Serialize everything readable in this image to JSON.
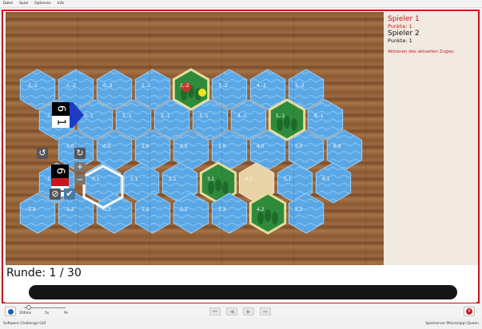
{
  "menu": [
    "Datei",
    "Spiel",
    "Optionen",
    "Info"
  ],
  "sidebar": {
    "player1_name": "Spieler 1",
    "player1_points": "Punkte: 1",
    "player2_name": "Spieler 2",
    "player2_points": "Punkte: 1",
    "actions_heading": "Aktionen des aktuellen Zuges:"
  },
  "round": {
    "label": "Runde: 1 / 30"
  },
  "speed": {
    "label": "200ms",
    "tick1": "5s",
    "tick2": "9s"
  },
  "status": {
    "left": "Software Challenge GUI",
    "right": "Spielserver Mississippi Queen"
  },
  "colors": {
    "frame": "#c8141e",
    "water": "#5aa7e6",
    "island": "#2e8b3c",
    "sand": "#e8d2a8",
    "player1": "#c8141e",
    "player2": "#1c3cc8"
  },
  "ship1": {
    "speed": "1",
    "coal": "6"
  },
  "ship2": {
    "speed": "1",
    "coal": "6"
  },
  "tiles": [
    {
      "label": "-2,-2",
      "kind": "water"
    },
    {
      "label": "-1,-2",
      "kind": "water"
    },
    {
      "label": "0,-2",
      "kind": "water"
    },
    {
      "label": "1,-2",
      "kind": "water"
    },
    {
      "label": "2,-2",
      "kind": "island"
    },
    {
      "label": "3,-2",
      "kind": "water"
    },
    {
      "label": "4,-2",
      "kind": "water"
    },
    {
      "label": "5,-2",
      "kind": "water"
    },
    {
      "label": "-1,-1",
      "kind": "water"
    },
    {
      "label": "0,-1",
      "kind": "water"
    },
    {
      "label": "1,-1",
      "kind": "water"
    },
    {
      "label": "2,-1",
      "kind": "water"
    },
    {
      "label": "3,-1",
      "kind": "water"
    },
    {
      "label": "4,-1",
      "kind": "water"
    },
    {
      "label": "5,-1",
      "kind": "island"
    },
    {
      "label": "6,-1",
      "kind": "water"
    },
    {
      "label": "-1,0",
      "kind": "water"
    },
    {
      "label": "0,0",
      "kind": "water"
    },
    {
      "label": "1,0",
      "kind": "water"
    },
    {
      "label": "2,0",
      "kind": "water"
    },
    {
      "label": "3,0",
      "kind": "water"
    },
    {
      "label": "4,0",
      "kind": "water"
    },
    {
      "label": "5,0",
      "kind": "water"
    },
    {
      "label": "6,0",
      "kind": "water"
    },
    {
      "label": "-1,1",
      "kind": "water"
    },
    {
      "label": "0,1",
      "kind": "water"
    },
    {
      "label": "1,1",
      "kind": "water"
    },
    {
      "label": "2,1",
      "kind": "water"
    },
    {
      "label": "3,1",
      "kind": "island"
    },
    {
      "label": "4,1",
      "kind": "sand"
    },
    {
      "label": "5,1",
      "kind": "water"
    },
    {
      "label": "6,1",
      "kind": "water"
    },
    {
      "label": "-2,2",
      "kind": "water"
    },
    {
      "label": "-1,2",
      "kind": "water"
    },
    {
      "label": "0,2",
      "kind": "water"
    },
    {
      "label": "1,2",
      "kind": "water"
    },
    {
      "label": "2,2",
      "kind": "water"
    },
    {
      "label": "3,2",
      "kind": "water"
    },
    {
      "label": "4,2",
      "kind": "island"
    },
    {
      "label": "5,2",
      "kind": "water"
    }
  ]
}
